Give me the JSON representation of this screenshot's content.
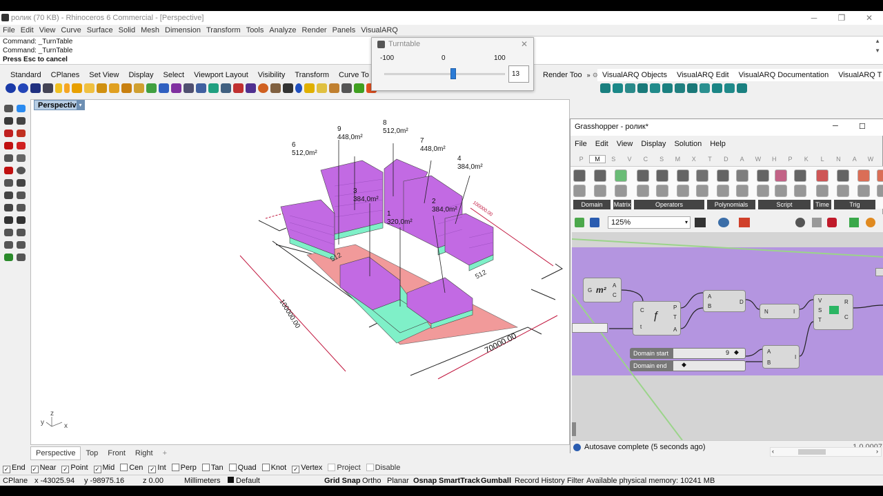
{
  "rhino": {
    "window_title": "ролик (70 KB) - Rhinoceros 6 Commercial - [Perspective]",
    "menu": [
      "File",
      "Edit",
      "View",
      "Curve",
      "Surface",
      "Solid",
      "Mesh",
      "Dimension",
      "Transform",
      "Tools",
      "Analyze",
      "Render",
      "Panels",
      "VisualARQ"
    ],
    "command_lines": [
      "Command: _TurnTable",
      "Command: _TurnTable",
      "Press Esc to cancel"
    ],
    "toolbar_tabs": [
      "Standard",
      "CPlanes",
      "Set View",
      "Display",
      "Select",
      "Viewport Layout",
      "Visibility",
      "Transform",
      "Curve To"
    ],
    "render_tab": "Render Too",
    "visualarq_tabs": [
      "VisualARQ Objects",
      "VisualARQ Edit",
      "VisualARQ Documentation",
      "VisualARQ T"
    ],
    "viewport_title": "Perspective",
    "viewport_tabs": [
      "Perspective",
      "Top",
      "Front",
      "Right"
    ],
    "add_tab": "+",
    "osnaps": [
      {
        "label": "End",
        "checked": true
      },
      {
        "label": "Near",
        "checked": true
      },
      {
        "label": "Point",
        "checked": true
      },
      {
        "label": "Mid",
        "checked": true
      },
      {
        "label": "Cen",
        "checked": false
      },
      {
        "label": "Int",
        "checked": true
      },
      {
        "label": "Perp",
        "checked": false
      },
      {
        "label": "Tan",
        "checked": false
      },
      {
        "label": "Quad",
        "checked": false
      },
      {
        "label": "Knot",
        "checked": false
      },
      {
        "label": "Vertex",
        "checked": true
      },
      {
        "label": "Project",
        "checked": false
      },
      {
        "label": "Disable",
        "checked": false
      }
    ],
    "status": {
      "cplane": "CPlane",
      "x": "x -43025.94",
      "y": "y -98975.16",
      "z": "z 0.00",
      "units": "Millimeters",
      "layer": "Default",
      "grid_snap": "Grid Snap",
      "ortho": "Ortho",
      "planar": "Planar",
      "osnap": "Osnap",
      "smarttrack": "SmartTrack",
      "gumball": "Gumball",
      "record_history": "Record History",
      "filter": "Filter",
      "memory": "Available physical memory: 10241 MB"
    }
  },
  "scene": {
    "labels": [
      {
        "num": "9",
        "area": "448,0m²"
      },
      {
        "num": "8",
        "area": "512,0m²"
      },
      {
        "num": "6",
        "area": "512,0m²"
      },
      {
        "num": "7",
        "area": "448,0m²"
      },
      {
        "num": "4",
        "area": "384,0m²"
      },
      {
        "num": "3",
        "area": "384,0m²"
      },
      {
        "num": "2",
        "area": "384,0m²"
      },
      {
        "num": "1",
        "area": "320,0m²"
      }
    ],
    "plot_labels": [
      "512",
      "512"
    ],
    "dim_left": "100000.00",
    "dim_bottom": "70000.00",
    "dim_top": "100000.00",
    "axis": {
      "x": "x",
      "y": "y",
      "z": "z"
    }
  },
  "turntable": {
    "title": "Turntable",
    "min_label": "-100",
    "zero_label": "0",
    "max_label": "100",
    "value": "13",
    "slider_fraction": 0.57
  },
  "grasshopper": {
    "title": "Grasshopper - ролик*",
    "menu": [
      "File",
      "Edit",
      "View",
      "Display",
      "Solution",
      "Help"
    ],
    "tabs": [
      "P",
      "M",
      "S",
      "V",
      "C",
      "S",
      "M",
      "X",
      "T",
      "D",
      "A",
      "W",
      "H",
      "P",
      "K",
      "L",
      "N",
      "A",
      "W"
    ],
    "active_tab": "M",
    "panels": [
      "Domain",
      "Matrix",
      "Operators",
      "Polynomials",
      "Script",
      "Time",
      "Trig"
    ],
    "zoom": "125%",
    "nodes": {
      "area_m2": "m²",
      "domain_start_label": "Domain start",
      "domain_start_value": "9",
      "domain_end_label": "Domain end"
    },
    "status": "Autosave complete (5 seconds ago)",
    "version": "1.0.0007"
  },
  "colors": {
    "purple": "#c26ae3",
    "teal": "#7ff0c8",
    "salmon": "#f19a9a",
    "dim": "#c0143c",
    "ghcanvas": "#b495e0"
  }
}
